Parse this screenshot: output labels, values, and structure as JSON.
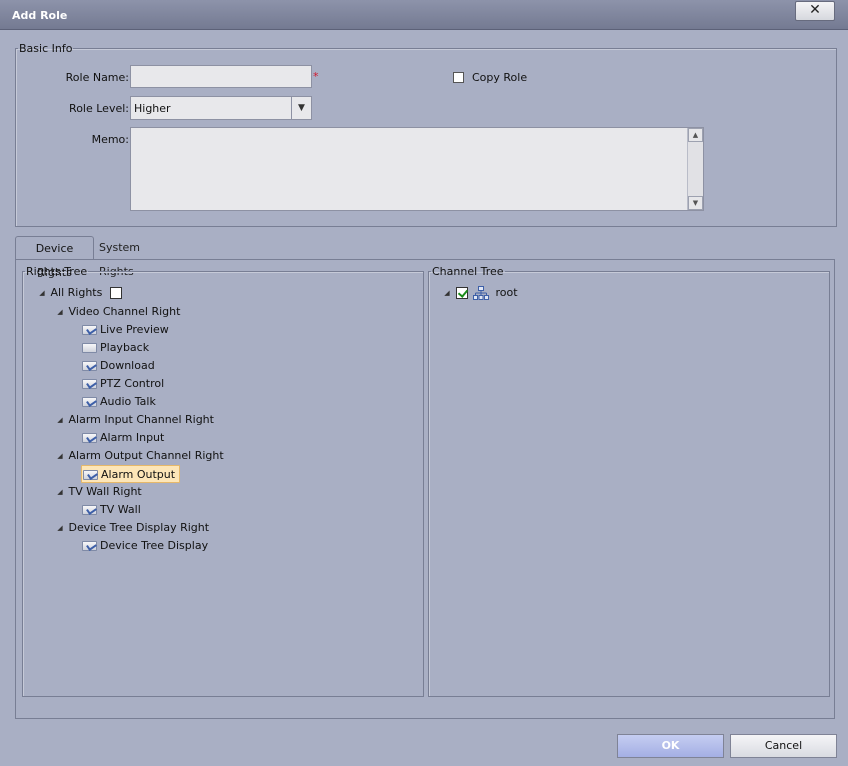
{
  "window": {
    "title": "Add Role",
    "close_glyph": "✕"
  },
  "basic_info": {
    "legend": "Basic Info",
    "role_name_label": "Role Name:",
    "role_name_value": "",
    "required_mark": "*",
    "copy_role_label": "Copy Role",
    "copy_role_checked": false,
    "role_level_label": "Role Level:",
    "role_level_value": "Higher",
    "memo_label": "Memo:",
    "memo_value": ""
  },
  "tabs": [
    {
      "label": "Device Rights",
      "active": true
    },
    {
      "label": "System Rights",
      "active": false
    }
  ],
  "rights_tree": {
    "legend": "Rights Tree",
    "root": {
      "label": "All Rights",
      "checked": false
    },
    "groups": [
      {
        "label": "Video Channel Right",
        "items": [
          "Live Preview",
          "Playback",
          "Download",
          "PTZ Control",
          "Audio Talk"
        ]
      },
      {
        "label": "Alarm Input Channel Right",
        "items": [
          "Alarm Input"
        ]
      },
      {
        "label": "Alarm Output Channel Right",
        "items": [
          "Alarm Output"
        ]
      },
      {
        "label": "TV Wall Right",
        "items": [
          "TV Wall"
        ]
      },
      {
        "label": "Device Tree Display Right",
        "items": [
          "Device Tree Display"
        ]
      }
    ],
    "selected_item": "Alarm Output"
  },
  "channel_tree": {
    "legend": "Channel Tree",
    "root": {
      "label": "root",
      "checked": true
    }
  },
  "buttons": {
    "ok": "OK",
    "cancel": "Cancel"
  },
  "icons": {
    "expander": "◢",
    "dropdown": "▼",
    "scroll_up": "▲",
    "scroll_down": "▼"
  }
}
